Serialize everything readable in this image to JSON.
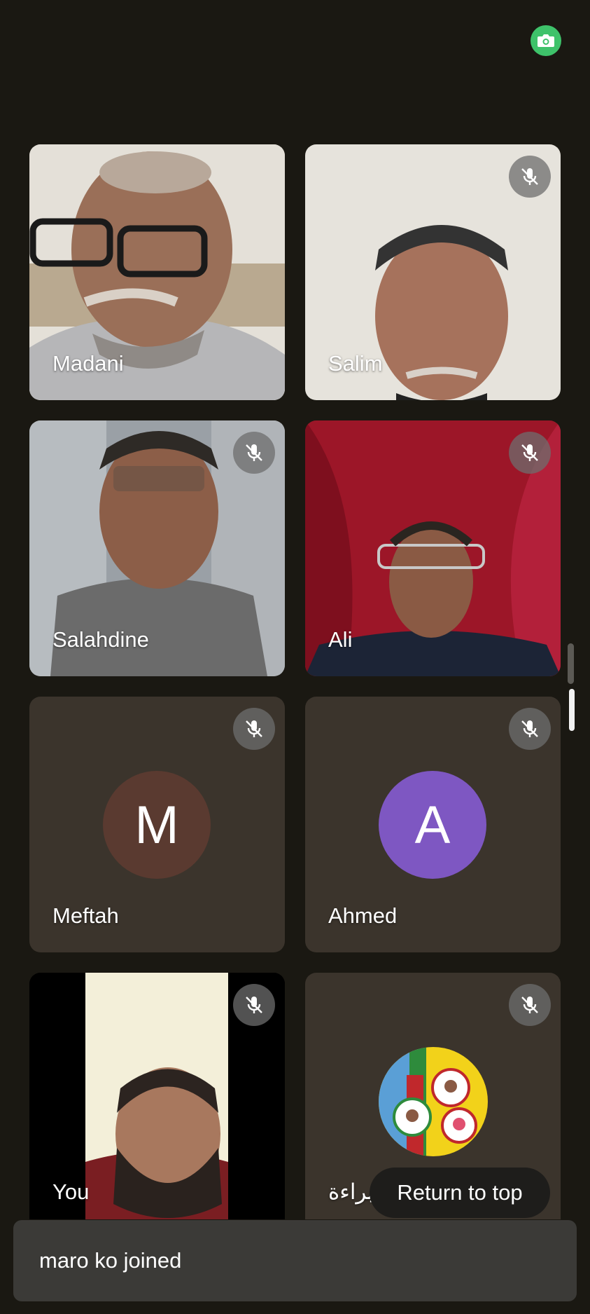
{
  "toolbar": {
    "camera_icon": "camera-flip-icon",
    "accent": "#3ec26a"
  },
  "participants": [
    {
      "name": "Madani",
      "muted": false,
      "video": true
    },
    {
      "name": "Salim",
      "muted": true,
      "video": true
    },
    {
      "name": "Salahdine",
      "muted": true,
      "video": true
    },
    {
      "name": "Ali",
      "muted": true,
      "video": true
    },
    {
      "name": "Meftah",
      "muted": true,
      "video": false,
      "initial": "M",
      "avatar_color": "#5a3a30"
    },
    {
      "name": "Ahmed",
      "muted": true,
      "video": false,
      "initial": "A",
      "avatar_color": "#7e57c2"
    },
    {
      "name": "You",
      "muted": true,
      "video": true
    },
    {
      "name": "براءة",
      "muted": true,
      "video": false
    }
  ],
  "return_to_top": {
    "label": "Return to top"
  },
  "toast": {
    "message": "maro ko joined"
  }
}
